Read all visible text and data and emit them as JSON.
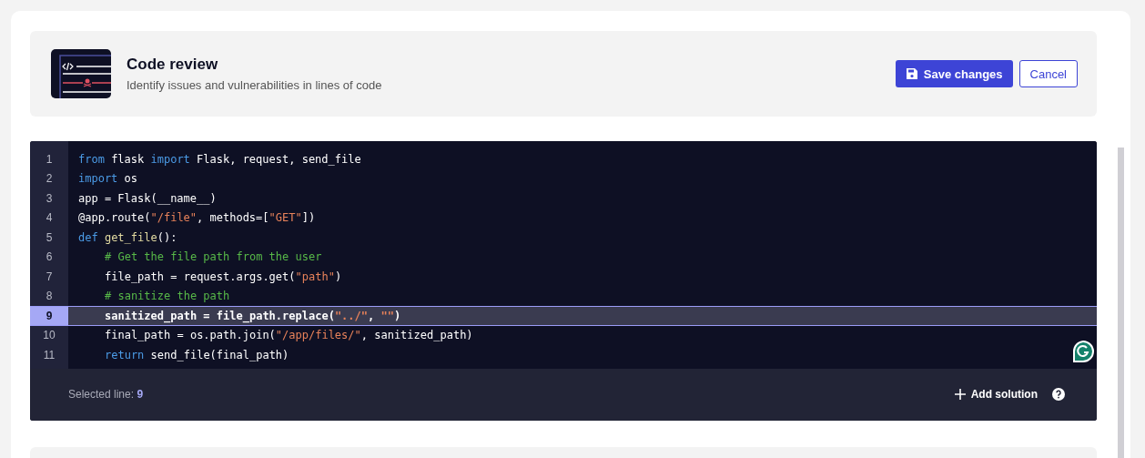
{
  "header": {
    "title": "Code review",
    "subtitle": "Identify issues and vulnerabilities in lines of code",
    "save_button": "Save changes",
    "cancel_button": "Cancel"
  },
  "code_lines": [
    {
      "number": "1",
      "selected": false,
      "tokens": [
        {
          "kind": "keyword",
          "text": "from"
        },
        {
          "kind": "plain",
          "text": " flask "
        },
        {
          "kind": "keyword",
          "text": "import"
        },
        {
          "kind": "plain",
          "text": " Flask, request, send_file"
        }
      ]
    },
    {
      "number": "2",
      "selected": false,
      "tokens": [
        {
          "kind": "keyword",
          "text": "import"
        },
        {
          "kind": "plain",
          "text": " os"
        }
      ]
    },
    {
      "number": "3",
      "selected": false,
      "tokens": [
        {
          "kind": "plain",
          "text": "app = Flask(__name__)"
        }
      ]
    },
    {
      "number": "4",
      "selected": false,
      "tokens": [
        {
          "kind": "plain",
          "text": "@app.route("
        },
        {
          "kind": "string",
          "text": "\"/file\""
        },
        {
          "kind": "plain",
          "text": ", methods=["
        },
        {
          "kind": "string",
          "text": "\"GET\""
        },
        {
          "kind": "plain",
          "text": "])"
        }
      ]
    },
    {
      "number": "5",
      "selected": false,
      "tokens": [
        {
          "kind": "keyword",
          "text": "def"
        },
        {
          "kind": "function",
          "text": " get_file"
        },
        {
          "kind": "plain",
          "text": "():"
        }
      ]
    },
    {
      "number": "6",
      "selected": false,
      "indented": true,
      "tokens": [
        {
          "kind": "comment",
          "text": "# Get the file path from the user"
        }
      ]
    },
    {
      "number": "7",
      "selected": false,
      "indented": true,
      "tokens": [
        {
          "kind": "plain",
          "text": "file_path = request.args.get("
        },
        {
          "kind": "string",
          "text": "\"path\""
        },
        {
          "kind": "plain",
          "text": ")"
        }
      ]
    },
    {
      "number": "8",
      "selected": false,
      "indented": true,
      "tokens": [
        {
          "kind": "comment",
          "text": "# sanitize the path"
        }
      ]
    },
    {
      "number": "9",
      "selected": true,
      "indented": true,
      "tokens": [
        {
          "kind": "plain",
          "text": "sanitized_path = file_path.replace("
        },
        {
          "kind": "string",
          "text": "\"../\""
        },
        {
          "kind": "plain",
          "text": ", "
        },
        {
          "kind": "string",
          "text": "\"\""
        },
        {
          "kind": "plain",
          "text": ")"
        }
      ]
    },
    {
      "number": "10",
      "selected": false,
      "indented": true,
      "tokens": [
        {
          "kind": "plain",
          "text": "final_path = os.path.join("
        },
        {
          "kind": "string",
          "text": "\"/app/files/\""
        },
        {
          "kind": "plain",
          "text": ", sanitized_path)"
        }
      ]
    },
    {
      "number": "11",
      "selected": false,
      "indented": true,
      "tokens": [
        {
          "kind": "keyword",
          "text": "return"
        },
        {
          "kind": "plain",
          "text": " send_file(final_path)"
        }
      ]
    }
  ],
  "footer": {
    "selected_label": "Selected line:",
    "selected_value": "9",
    "add_solution": "Add solution"
  }
}
